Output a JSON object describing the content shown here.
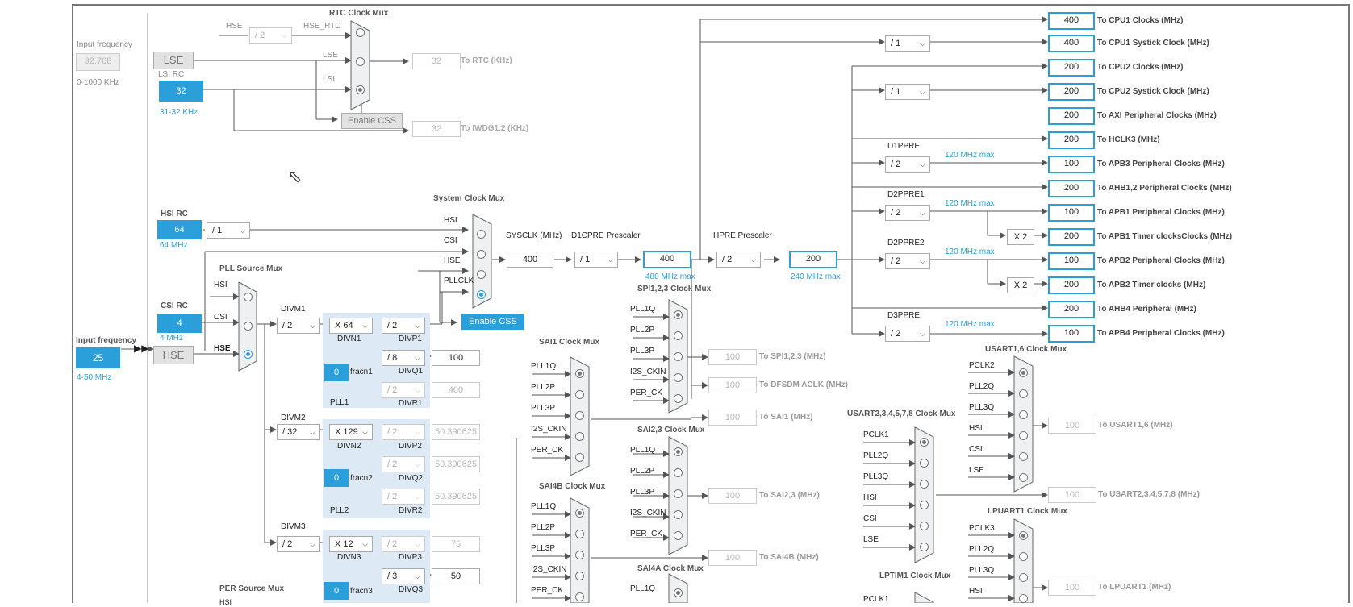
{
  "rtc": {
    "title": "RTC Clock Mux",
    "hse_label": "HSE",
    "hse_div": "/ 2",
    "hse_rtc_label": "HSE_RTC",
    "lse_label": "LSE",
    "lsi_label": "LSI",
    "out_value": "32",
    "out_label": "To RTC (KHz)",
    "iwdg_value": "32",
    "iwdg_label": "To IWDG1,2 (KHz)",
    "enable_css": "Enable CSS"
  },
  "lse": {
    "input_freq_label": "Input frequency",
    "input_freq_value": "32.768",
    "range": "0-1000 KHz",
    "box": "LSE"
  },
  "lsi": {
    "title": "LSI RC",
    "value": "32",
    "range": "31-32 KHz"
  },
  "hsi": {
    "title": "HSI RC",
    "value": "64",
    "freq": "64 MHz",
    "div": "/ 1"
  },
  "csi": {
    "title": "CSI RC",
    "value": "4",
    "freq": "4 MHz"
  },
  "hse": {
    "input_freq_label": "Input frequency",
    "value": "25",
    "range": "4-50 MHz",
    "box": "HSE"
  },
  "pll_source_mux": {
    "title": "PLL Source Mux",
    "inputs": [
      "HSI",
      "CSI",
      "HSE"
    ]
  },
  "sysclk_mux": {
    "title": "System Clock Mux",
    "inputs": [
      "HSI",
      "CSI",
      "HSE",
      "PLLCLK"
    ],
    "enable_css": "Enable CSS"
  },
  "sysclk": {
    "label": "SYSCLK (MHz)",
    "value": "400",
    "d1cpre_label": "D1CPRE Prescaler",
    "d1cpre": "/ 1",
    "cpu_value": "400",
    "cpu_max": "480 MHz max",
    "hpre_label": "HPRE Prescaler",
    "hpre": "/ 2",
    "hclk_value": "200",
    "hclk_max": "240 MHz max"
  },
  "pll1": {
    "divm_label": "DIVM1",
    "divm": "/ 2",
    "divn": "X 64",
    "divn_label": "DIVN1",
    "divp": "/ 2",
    "divp_label": "DIVP1",
    "divq": "/ 8",
    "divq_label": "DIVQ1",
    "q_out": "100",
    "divr": "/ 2",
    "divr_label": "DIVR1",
    "r_out": "400",
    "fracn": "0",
    "fracn_label": "fracn1",
    "name": "PLL1"
  },
  "pll2": {
    "divm_label": "DIVM2",
    "divm": "/ 32",
    "divn": "X 129",
    "divn_label": "DIVN2",
    "divp": "/ 2",
    "divp_label": "DIVP2",
    "p_out": "50.390625",
    "divq": "/ 2",
    "divq_label": "DIVQ2",
    "q_out": "50.390625",
    "divr": "/ 2",
    "divr_label": "DIVR2",
    "r_out": "50.390625",
    "fracn": "0",
    "fracn_label": "fracn2",
    "name": "PLL2"
  },
  "pll3": {
    "divm_label": "DIVM3",
    "divm": "/ 2",
    "divn": "X 12",
    "divn_label": "DIVN3",
    "divp": "/ 2",
    "divp_label": "DIVP3",
    "p_out": "75",
    "divq": "/ 3",
    "divq_label": "DIVQ3",
    "q_out": "50",
    "fracn": "0",
    "fracn_label": "fracn3"
  },
  "per_mux": {
    "title": "PER Source Mux",
    "input": "HSI"
  },
  "outputs": [
    {
      "value": "400",
      "label": "To CPU1 Clocks (MHz)"
    },
    {
      "value": "400",
      "label": "To CPU1 Systick Clock (MHz)",
      "div": "/ 1"
    },
    {
      "value": "200",
      "label": "To CPU2 Clocks (MHz)"
    },
    {
      "value": "200",
      "label": "To CPU2 Systick Clock (MHz)",
      "div": "/ 1"
    },
    {
      "value": "200",
      "label": "To AXI Peripheral Clocks (MHz)"
    },
    {
      "value": "200",
      "label": "To HCLK3 (MHz)"
    },
    {
      "value": "100",
      "label": "To APB3 Peripheral Clocks (MHz)",
      "pre": "D1PPRE",
      "div": "/ 2",
      "max": "120 MHz max"
    },
    {
      "value": "200",
      "label": "To AHB1,2 Peripheral Clocks (MHz)"
    },
    {
      "value": "100",
      "label": "To APB1 Peripheral Clocks (MHz)",
      "pre": "D2PPRE1",
      "div": "/ 2",
      "max": "120 MHz max"
    },
    {
      "value": "200",
      "label": "To APB1 Timer clocksClocks (MHz)",
      "mult": "X 2"
    },
    {
      "value": "100",
      "label": "To APB2 Peripheral Clocks (MHz)",
      "pre": "D2PPRE2",
      "div": "/ 2",
      "max": "120 MHz max"
    },
    {
      "value": "200",
      "label": "To APB2 Timer clocks (MHz)",
      "mult": "X 2"
    },
    {
      "value": "200",
      "label": "To AHB4 Peripheral (MHz)"
    },
    {
      "value": "100",
      "label": "To APB4 Peripheral Clocks (MHz)",
      "pre": "D3PPRE",
      "div": "/ 2",
      "max": "120 MHz max"
    }
  ],
  "spi_mux": {
    "title": "SPI1,2,3 Clock Mux",
    "inputs": [
      "PLL1Q",
      "PLL2P",
      "PLL3P",
      "I2S_CKIN",
      "PER_CK"
    ],
    "out1_value": "100",
    "out1_label": "To SPI1,2,3 (MHz)",
    "out2_value": "100",
    "out2_label": "To DFSDM ACLK (MHz)"
  },
  "sai1_mux": {
    "title": "SAI1 Clock Mux",
    "inputs": [
      "PLL1Q",
      "PLL2P",
      "PLL3P",
      "I2S_CKIN",
      "PER_CK"
    ],
    "out_value": "100",
    "out_label": "To SAI1 (MHz)"
  },
  "sai23_mux": {
    "title": "SAI2,3 Clock Mux",
    "inputs": [
      "PLL1Q",
      "PLL2P",
      "PLL3P",
      "I2S_CKIN",
      "PER_CK"
    ],
    "out_value": "100",
    "out_label": "To SAI2,3 (MHz)"
  },
  "sai4b_mux": {
    "title": "SAI4B Clock Mux",
    "inputs": [
      "PLL1Q",
      "PLL2P",
      "PLL3P",
      "I2S_CKIN",
      "PER_CK"
    ],
    "out_value": "100",
    "out_label": "To SAI4B (MHz)"
  },
  "sai4a_mux": {
    "title": "SAI4A Clock Mux",
    "inputs": [
      "PLL1Q"
    ]
  },
  "usart16_mux": {
    "title": "USART1,6 Clock Mux",
    "inputs": [
      "PCLK2",
      "PLL2Q",
      "PLL3Q",
      "HSI",
      "CSI",
      "LSE"
    ],
    "out_value": "100",
    "out_label": "To USART1,6 (MHz)"
  },
  "usart2_mux": {
    "title": "USART2,3,4,5,7,8 Clock Mux",
    "inputs": [
      "PCLK1",
      "PLL2Q",
      "PLL3Q",
      "HSI",
      "CSI",
      "LSE"
    ],
    "out_value": "100",
    "out_label": "To USART2,3,4,5,7,8 (MHz)"
  },
  "lpuart_mux": {
    "title": "LPUART1 Clock Mux",
    "inputs": [
      "PCLK3",
      "PLL2Q",
      "PLL3Q",
      "HSI"
    ],
    "out_value": "100",
    "out_label": "To LPUART1 (MHz)"
  },
  "lptim_mux": {
    "title": "LPTIM1 Clock Mux",
    "inputs": [
      "PCLK1"
    ]
  },
  "colors": {
    "accent": "#2b9fd9",
    "pll_bg": "#dde9f4",
    "line": "#555555"
  }
}
